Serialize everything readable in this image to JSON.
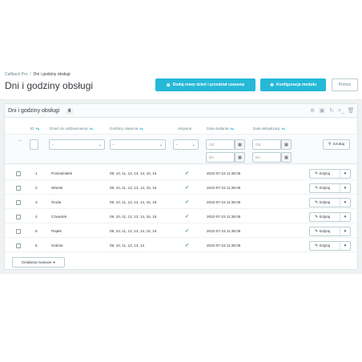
{
  "breadcrumb": {
    "parent": "Callback Pro",
    "current": "Dni i godziny obsługi"
  },
  "page_title": "Dni i godziny obsługi",
  "header_buttons": {
    "add": "Dodaj nowy dzień i przedział czasowy",
    "config": "Konfiguracja modułu",
    "help": "Pomoc"
  },
  "card": {
    "title": "Dni i godziny obsługi",
    "count": "6"
  },
  "columns": {
    "id": "ID",
    "day": "Dzień do oddzwonienia",
    "hours": "Godziny otwarcia",
    "active": "Aktywne",
    "date_add": "Data dodania",
    "date_upd": "Data aktualizacji"
  },
  "filters": {
    "select_placeholder": "-",
    "from_placeholder": "Od",
    "to_placeholder": "Do",
    "search_button": "Szukaj"
  },
  "rows": [
    {
      "id": "1",
      "day": "Poniedziałek",
      "hours": "09, 10, 11, 12, 13, 14, 15, 16",
      "date_add": "2022-07-23 11:35:06"
    },
    {
      "id": "2",
      "day": "Wtorek",
      "hours": "09, 10, 11, 12, 13, 14, 15, 16",
      "date_add": "2022-07-23 11:35:06"
    },
    {
      "id": "3",
      "day": "Środa",
      "hours": "09, 10, 11, 12, 13, 14, 15, 16",
      "date_add": "2022-07-23 11:35:06"
    },
    {
      "id": "4",
      "day": "Czwartek",
      "hours": "09, 10, 11, 12, 13, 14, 15, 16",
      "date_add": "2022-07-23 11:35:06"
    },
    {
      "id": "5",
      "day": "Piątek",
      "hours": "09, 10, 11, 12, 13, 14, 15, 16",
      "date_add": "2022-07-23 11:35:06"
    },
    {
      "id": "6",
      "day": "Sobota",
      "hours": "09, 10, 11, 12, 13, 14",
      "date_add": "2022-07-23 11:35:06"
    }
  ],
  "row_action": "Edytuj",
  "bulk_actions": "Działania masowe",
  "colors": {
    "accent": "#25b9d7",
    "active_check": "#70b580"
  },
  "icons": {
    "add_button": "plus-circle-icon",
    "config_button": "puzzle-icon",
    "row_active": "check-icon",
    "row_edit": "pencil-icon",
    "search_button": "search-icon",
    "date_filter": "calendar-icon"
  }
}
